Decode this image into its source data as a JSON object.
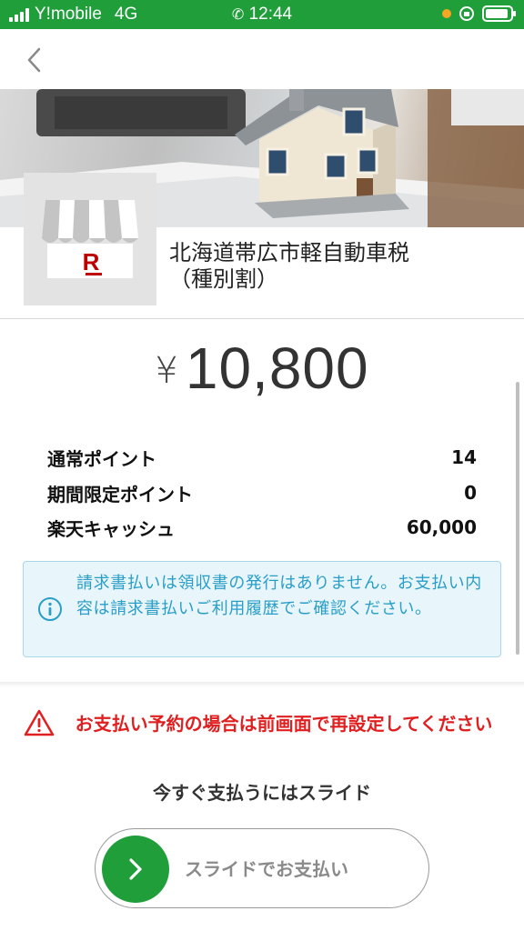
{
  "status_bar": {
    "carrier": "Y!mobile",
    "network": "4G",
    "time": "12:44"
  },
  "shop": {
    "name_line1": "北海道帯広市軽自動車税",
    "name_line2": "（種別割）",
    "logo_letter": "R"
  },
  "payment": {
    "currency_symbol": "¥",
    "amount": "10,800"
  },
  "points": [
    {
      "label": "通常ポイント",
      "value": "14"
    },
    {
      "label": "期間限定ポイント",
      "value": "0"
    },
    {
      "label": "楽天キャッシュ",
      "value": "60,000"
    }
  ],
  "info": {
    "text": "請求書払いは領収書の発行はありません。お支払い内容は請求書払いご利用履歴でご確認ください。"
  },
  "warning": {
    "text": "お支払い予約の場合は前画面で再設定してください"
  },
  "slide": {
    "hint": "今すぐ支払うにはスライド",
    "label": "スライドでお支払い"
  },
  "colors": {
    "brand_green": "#1f9e3a",
    "warning_red": "#e02020",
    "info_blue": "#2a9ec9",
    "rakuten_red": "#bf0000"
  }
}
